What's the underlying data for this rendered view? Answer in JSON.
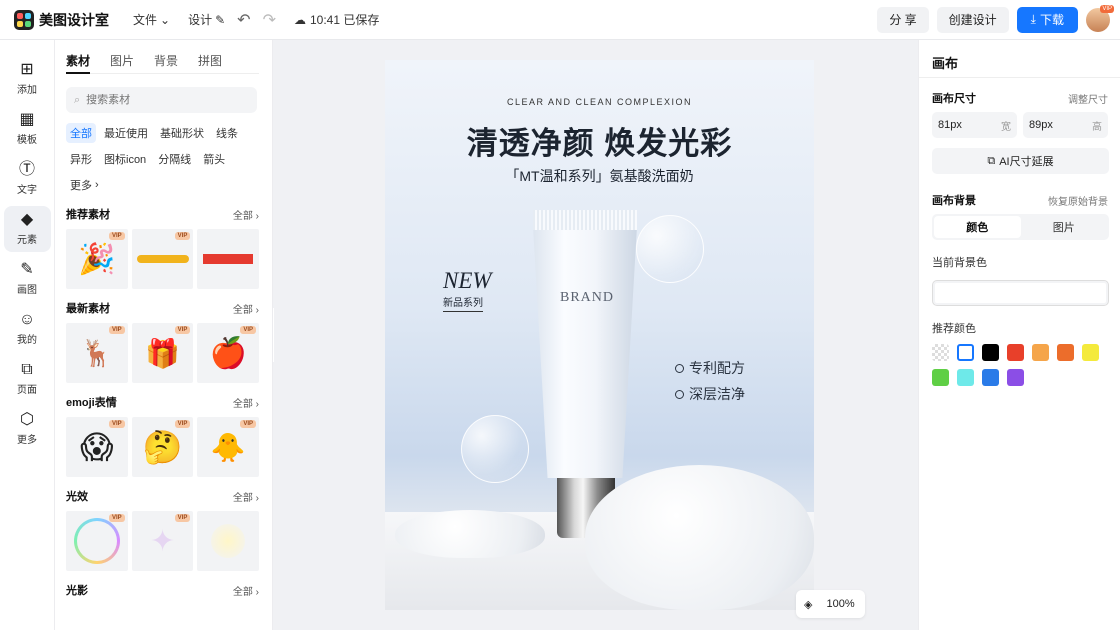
{
  "header": {
    "app_name": "美图设计室",
    "menu_file": "文件",
    "menu_design": "设计",
    "save_status": "10:41 已保存",
    "share_label": "分 享",
    "create_label": "创建设计",
    "download_label": "下载",
    "avatar_badge": "VIP"
  },
  "rail": [
    {
      "label": "添加",
      "icon": "plus-square-icon"
    },
    {
      "label": "模板",
      "icon": "layout-icon"
    },
    {
      "label": "文字",
      "icon": "text-icon"
    },
    {
      "label": "元素",
      "icon": "shapes-icon"
    },
    {
      "label": "画图",
      "icon": "pencil-icon"
    },
    {
      "label": "我的",
      "icon": "user-icon"
    },
    {
      "label": "页面",
      "icon": "page-icon"
    },
    {
      "label": "更多",
      "icon": "cube-icon"
    }
  ],
  "panel": {
    "tabs": [
      "素材",
      "图片",
      "背景",
      "拼图"
    ],
    "search_placeholder": "搜索素材",
    "chips": [
      "全部",
      "最近使用",
      "基础形状",
      "线条",
      "异形",
      "图标icon",
      "分隔线",
      "箭头",
      "更多"
    ],
    "all_label": "全部",
    "vip_label": "VIP",
    "sections": [
      {
        "title": "推荐素材"
      },
      {
        "title": "最新素材"
      },
      {
        "title": "emoji表情"
      },
      {
        "title": "光效"
      },
      {
        "title": "光影"
      }
    ]
  },
  "artboard": {
    "subtitle": "CLEAR AND CLEAN COMPLEXION",
    "title": "清透净颜 焕发光彩",
    "desc": "「MT温和系列」氨基酸洗面奶",
    "new_label": "NEW",
    "new_cn": "新品系列",
    "brand": "BRAND",
    "feature_1": "专利配方",
    "feature_2": "深层洁净"
  },
  "zoom": {
    "level": "100%"
  },
  "right": {
    "title": "画布",
    "size_label": "画布尺寸",
    "adjust_size": "调整尺寸",
    "width_value": "81px",
    "width_unit": "宽",
    "height_value": "89px",
    "height_unit": "高",
    "ai_extend": "AI尺寸延展",
    "bg_label": "画布背景",
    "restore_bg": "恢复原始背景",
    "seg_color": "颜色",
    "seg_image": "图片",
    "current_bg": "当前背景色",
    "recommend": "推荐颜色",
    "colors": [
      "transparent",
      "#ffffff",
      "#000000",
      "#e8402a",
      "#f5a54a",
      "#ec6d2b",
      "#f4ea3c",
      "#5fcf45",
      "#6ee9e9",
      "#2a7be8",
      "#8b4ee6"
    ]
  }
}
